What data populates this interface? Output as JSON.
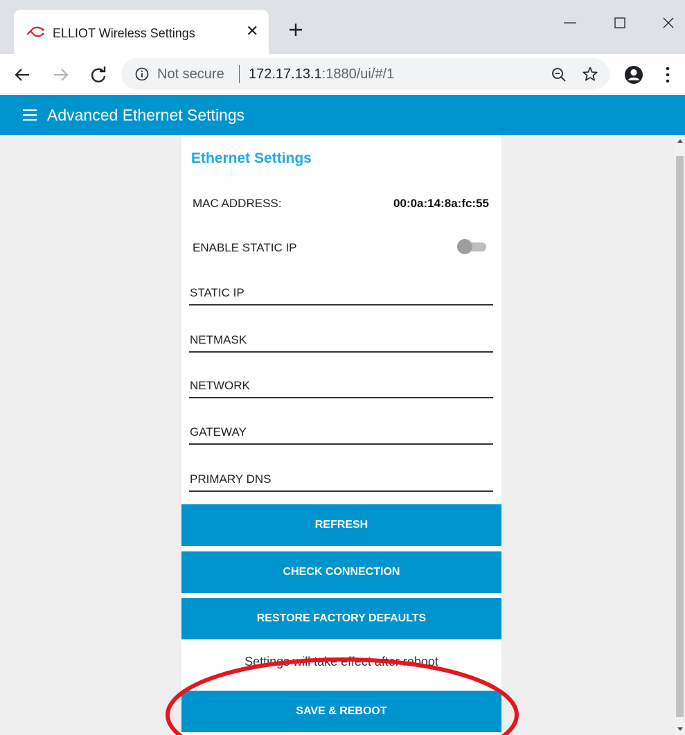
{
  "browser": {
    "tab_title": "ELLIOT Wireless Settings",
    "security_label": "Not secure",
    "url_host": "172.17.13.1",
    "url_rest": ":1880/ui/#/1"
  },
  "header": {
    "title": "Advanced Ethernet Settings"
  },
  "settings": {
    "section_title": "Ethernet Settings",
    "mac_label": "MAC ADDRESS:",
    "mac_value": "00:0a:14:8a:fc:55",
    "static_ip_toggle_label": "ENABLE STATIC IP",
    "static_ip_enabled": false,
    "fields": [
      {
        "label": "STATIC IP",
        "value": ""
      },
      {
        "label": "NETMASK",
        "value": ""
      },
      {
        "label": "NETWORK",
        "value": ""
      },
      {
        "label": "GATEWAY",
        "value": ""
      },
      {
        "label": "PRIMARY DNS",
        "value": ""
      }
    ],
    "buttons": {
      "refresh": "REFRESH",
      "check_connection": "CHECK CONNECTION",
      "restore_defaults": "RESTORE FACTORY DEFAULTS",
      "save_reboot": "SAVE & REBOOT"
    },
    "reboot_note": "Settings will take effect after reboot"
  },
  "colors": {
    "accent": "#0094ce",
    "section_title": "#1fa9e1",
    "annotation": "#e8141e"
  },
  "icons": [
    "favicon-icon",
    "close-icon",
    "plus-icon",
    "minimize-icon",
    "maximize-icon",
    "window-close-icon",
    "back-icon",
    "forward-icon",
    "reload-icon",
    "info-icon",
    "zoom-icon",
    "star-icon",
    "profile-icon",
    "menu-icon",
    "hamburger-icon"
  ]
}
